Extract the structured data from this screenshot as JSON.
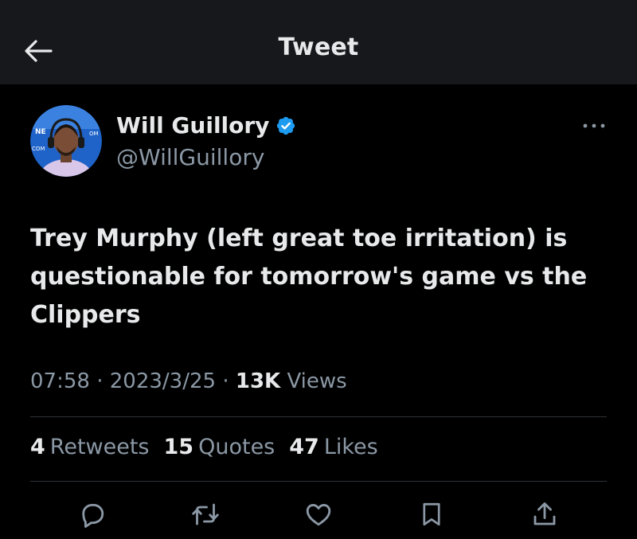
{
  "header": {
    "title": "Tweet",
    "back_icon": "arrow-left-icon"
  },
  "author": {
    "display_name": "Will Guillory",
    "handle": "@WillGuillory",
    "verified_icon": "verified-badge-icon",
    "verified_color": "#1d9bf0"
  },
  "tweet": {
    "text": "Trey Murphy (left great toe irritation) is questionable for tomorrow's game vs the Clippers",
    "time": "07:58",
    "date": "2023/3/25",
    "views_count": "13K",
    "views_label": "Views",
    "separator": "·"
  },
  "stats": [
    {
      "count": "4",
      "label": "Retweets"
    },
    {
      "count": "15",
      "label": "Quotes"
    },
    {
      "count": "47",
      "label": "Likes"
    }
  ],
  "actions": [
    "reply-icon",
    "retweet-icon",
    "like-icon",
    "bookmark-icon",
    "share-icon"
  ],
  "colors": {
    "background": "#000000",
    "header_bg": "#16181c",
    "text": "#e7e9ea",
    "secondary": "#8b98a5",
    "divider": "#2f3336"
  }
}
